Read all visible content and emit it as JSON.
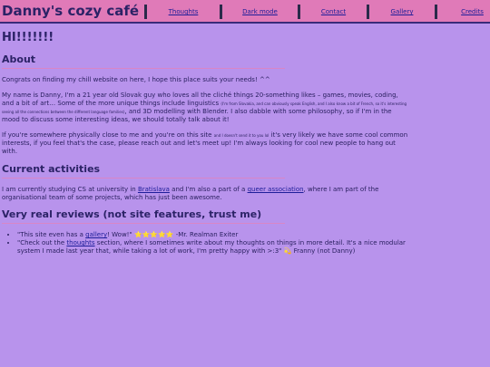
{
  "header": {
    "site_title": "Danny's cozy café",
    "nav": [
      "Thoughts",
      "Dark mode",
      "Contact",
      "Gallery",
      "Credits"
    ]
  },
  "main": {
    "greeting": "HI!!!!!!!",
    "about": {
      "heading": "About",
      "p1": "Congrats on finding my chill website on here, I hope this place suits your needs! ^^",
      "p2_a": "My name is Danny, I'm a 21 year old Slovak guy who loves all the cliché things 20-something likes – games, movies, coding, and a bit of art… Some of the more unique things include linguistics",
      "p2_small": "(I'm from Slovakia, and can obviously speak English, and I also know a bit of French, so it's interesting seeing all the connections between the different language families)",
      "p2_b": ", and 3D modelling with Blender. I also dabble with some philosophy, so if I'm in the mood to discuss some interesting ideas, we should totally talk about it!",
      "p3_a": "If you're somewhere physically close to me and you're on this site",
      "p3_small": "and I doesn't send it to you lol",
      "p3_b": "it's very likely we have some cool common interests, if you feel that's the case, please reach out and let's meet up! I'm always looking for cool new people to hang out with."
    },
    "activities": {
      "heading": "Current activities",
      "text_a": "I am currently studying CS at university in",
      "link1": "Bratislava",
      "text_b": "and I'm also a part of a",
      "link2": "queer association",
      "text_c": ", where I am part of the organisational team of some projects, which has just been awesome."
    },
    "reviews": {
      "heading": "Very real reviews (not site features, trust me)",
      "r1_a": "\"This site even has a",
      "r1_link": "gallery",
      "r1_b": "! Wow!\"",
      "r1_stars": "⭐⭐⭐⭐⭐",
      "r1_c": "-Mr. Realman Exiter",
      "r2_a": "\"Check out the",
      "r2_link": "thoughts",
      "r2_b": "section, where I sometimes write about my thoughts on things in more detail. It's a nice modular system I made last year that, while taking a lot of work, I'm pretty happy with >:3\"",
      "r2_emoji": "💫",
      "r2_c": "Franny (not Danny)"
    }
  }
}
